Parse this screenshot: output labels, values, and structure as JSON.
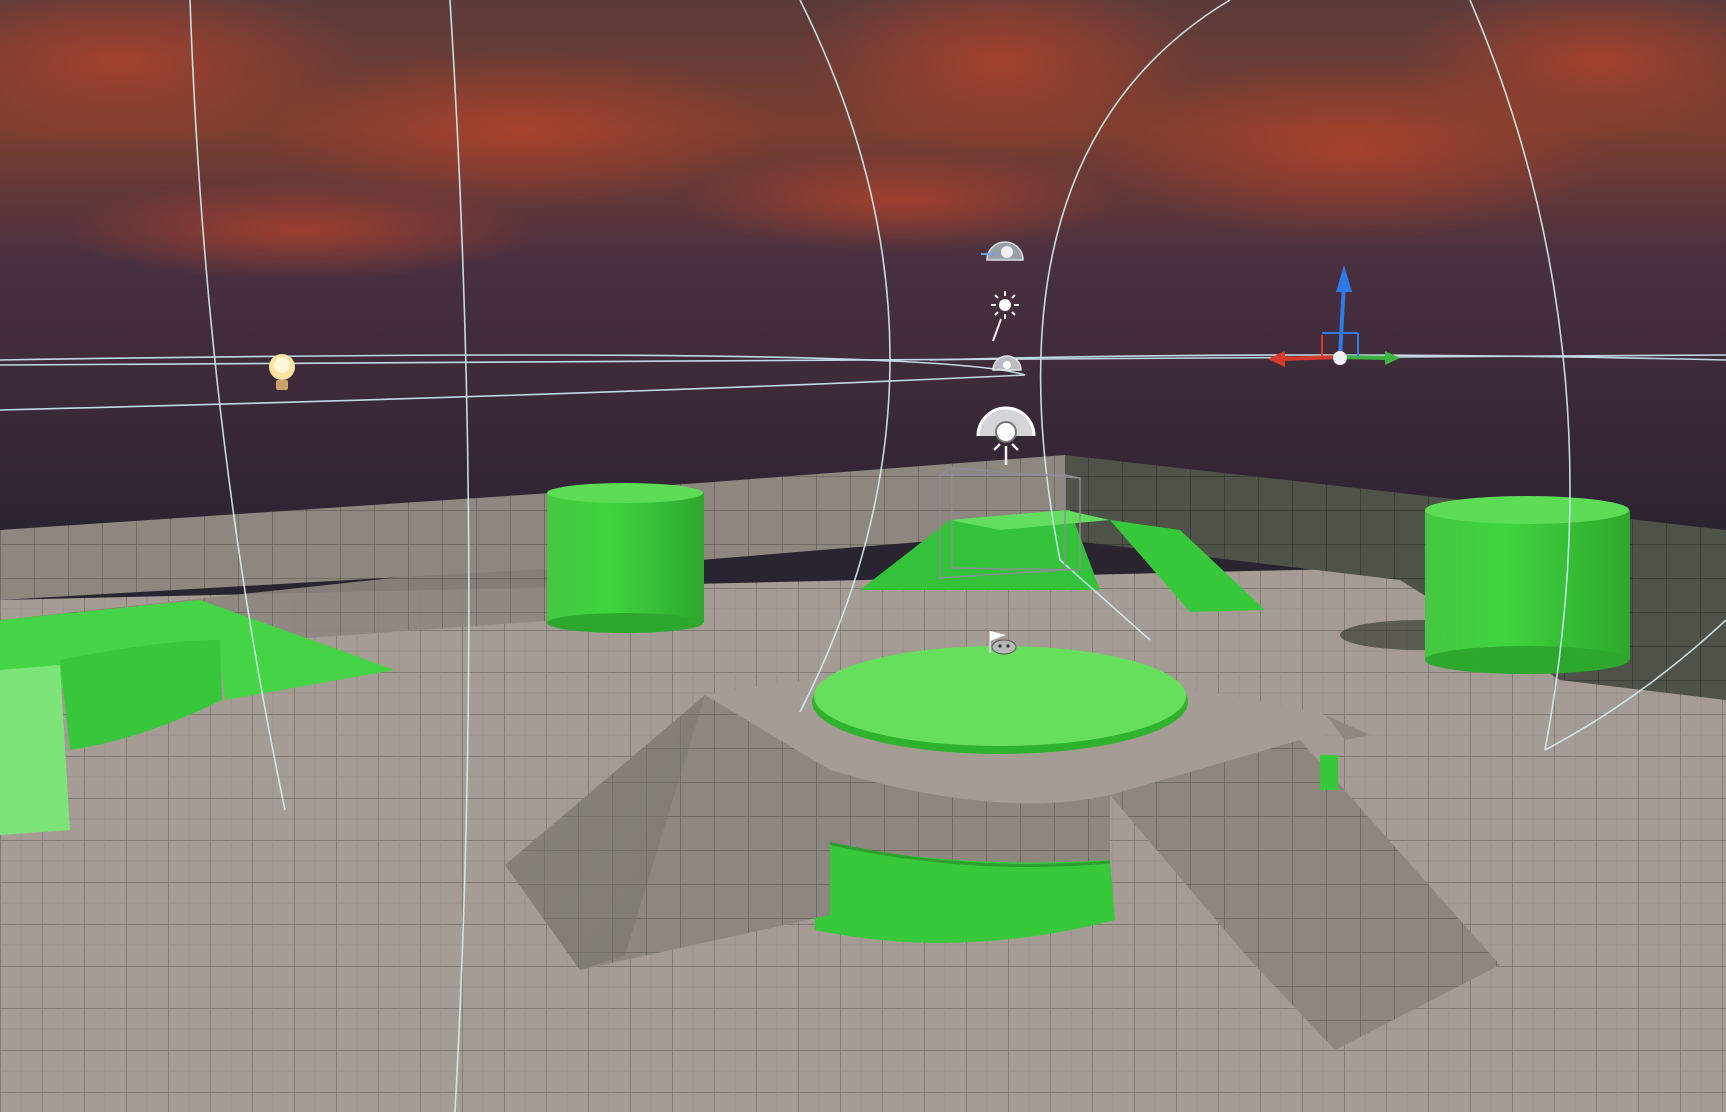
{
  "viewport": {
    "kind": "3d-level-editor-viewport",
    "sky": "sunset-clouds",
    "floor_material": "grey-grid",
    "accent_color": "#3fd43f",
    "axis_colors": {
      "x": "#d63a2a",
      "y": "#3cb43c",
      "z": "#2f7bea"
    }
  },
  "icons": [
    "point-light-icon",
    "sky-atmosphere-icon",
    "directional-light-icon",
    "skylight-icon",
    "exponential-fog-icon",
    "player-start-icon",
    "transform-gizmo"
  ],
  "objects": [
    "green-cylinder-back-left",
    "green-cylinder-back-right",
    "green-disc-center",
    "green-ring-base",
    "green-ramp-left",
    "green-platform-back-center",
    "grey-ramp-left",
    "grey-ramp-right",
    "grey-wall-left",
    "grey-wall-right"
  ]
}
